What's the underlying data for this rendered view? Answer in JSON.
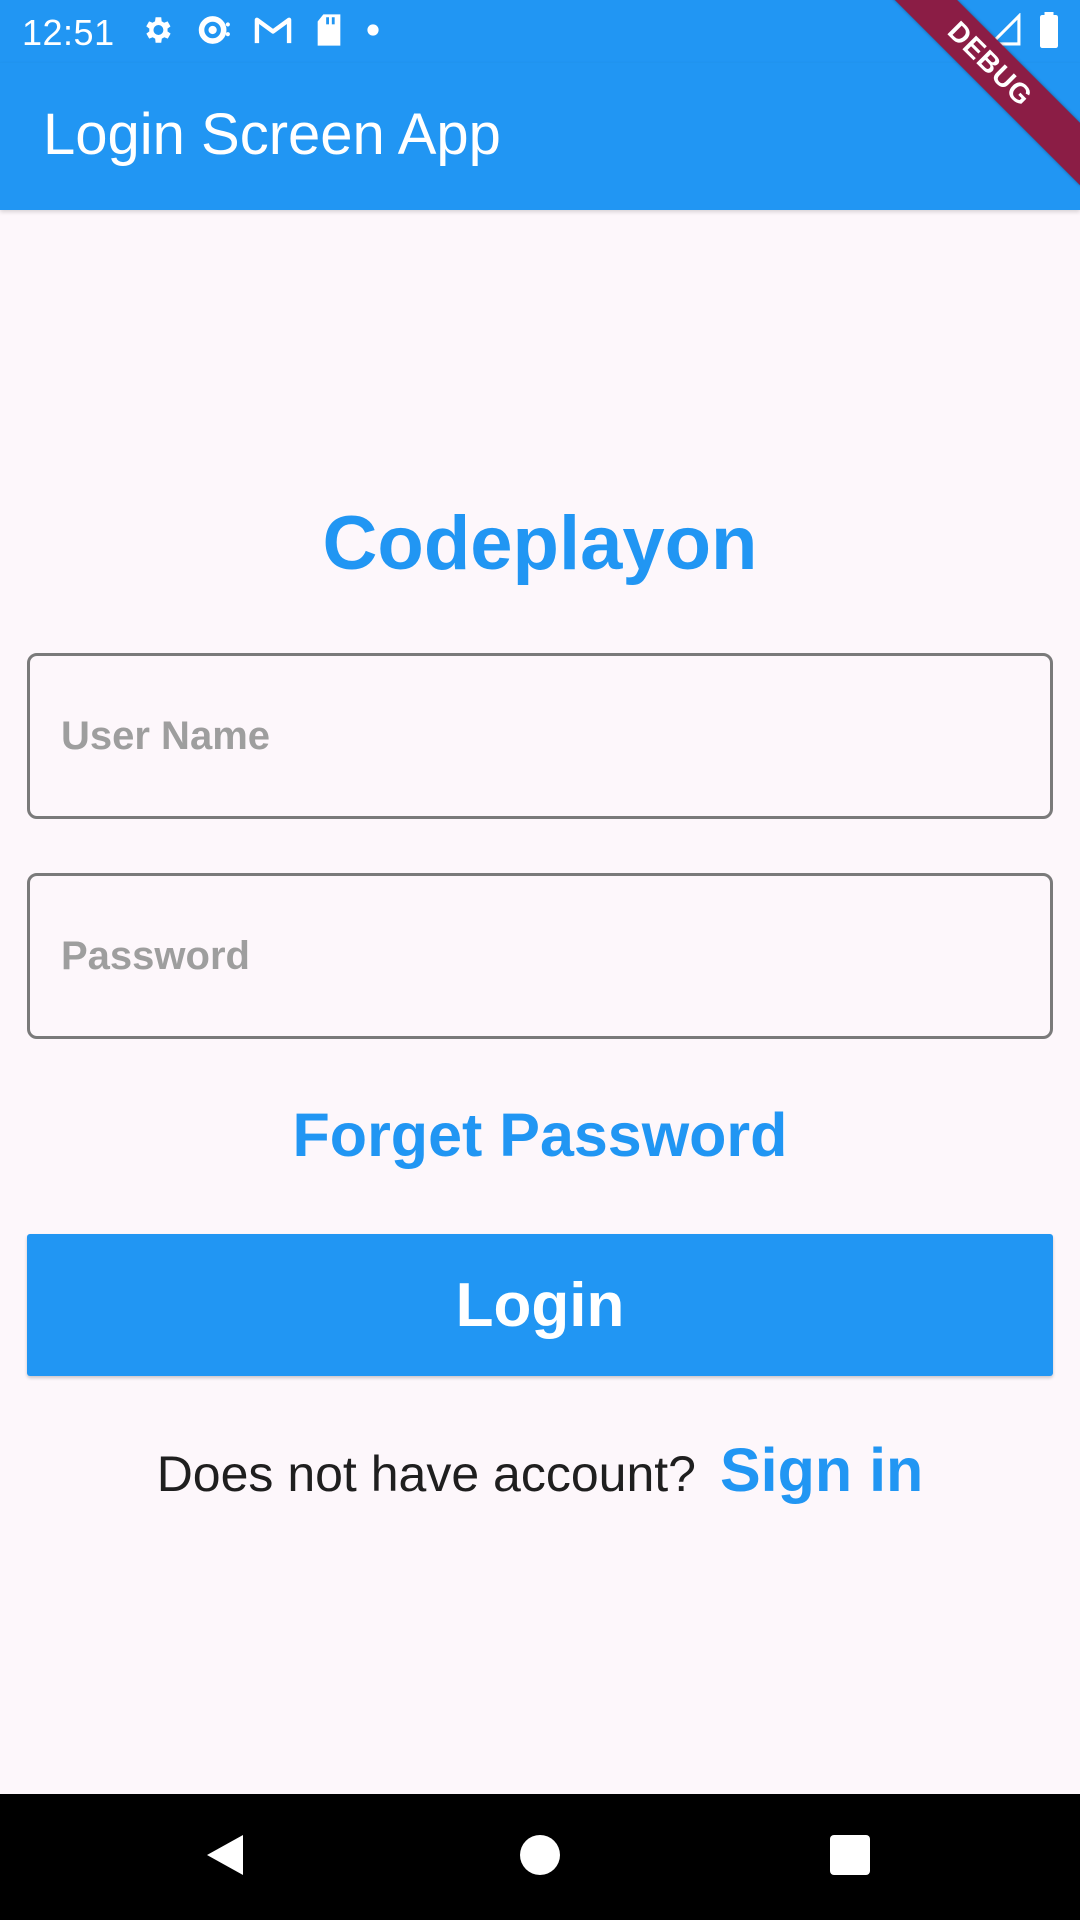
{
  "status_bar": {
    "time": "12:51",
    "left_icons": [
      "gear-icon",
      "sync-icon",
      "gmail-icon",
      "sd-card-icon",
      "dot-icon"
    ],
    "right_icons": [
      "wifi-icon",
      "signal-icon",
      "battery-icon"
    ]
  },
  "app_bar": {
    "title": "Login Screen App",
    "debug_banner": "DEBUG"
  },
  "brand": "Codeplayon",
  "form": {
    "username_placeholder": "User Name",
    "username_value": "",
    "password_placeholder": "Password",
    "password_value": "",
    "forget_password_label": "Forget Password",
    "login_label": "Login"
  },
  "signup": {
    "prompt": "Does not have account?",
    "link_label": "Sign in"
  },
  "nav_bar": {
    "buttons": [
      "back-icon",
      "home-icon",
      "recents-icon"
    ]
  },
  "colors": {
    "primary": "#2196f3",
    "background": "#fdf7fb",
    "debug": "#8b1d45"
  }
}
